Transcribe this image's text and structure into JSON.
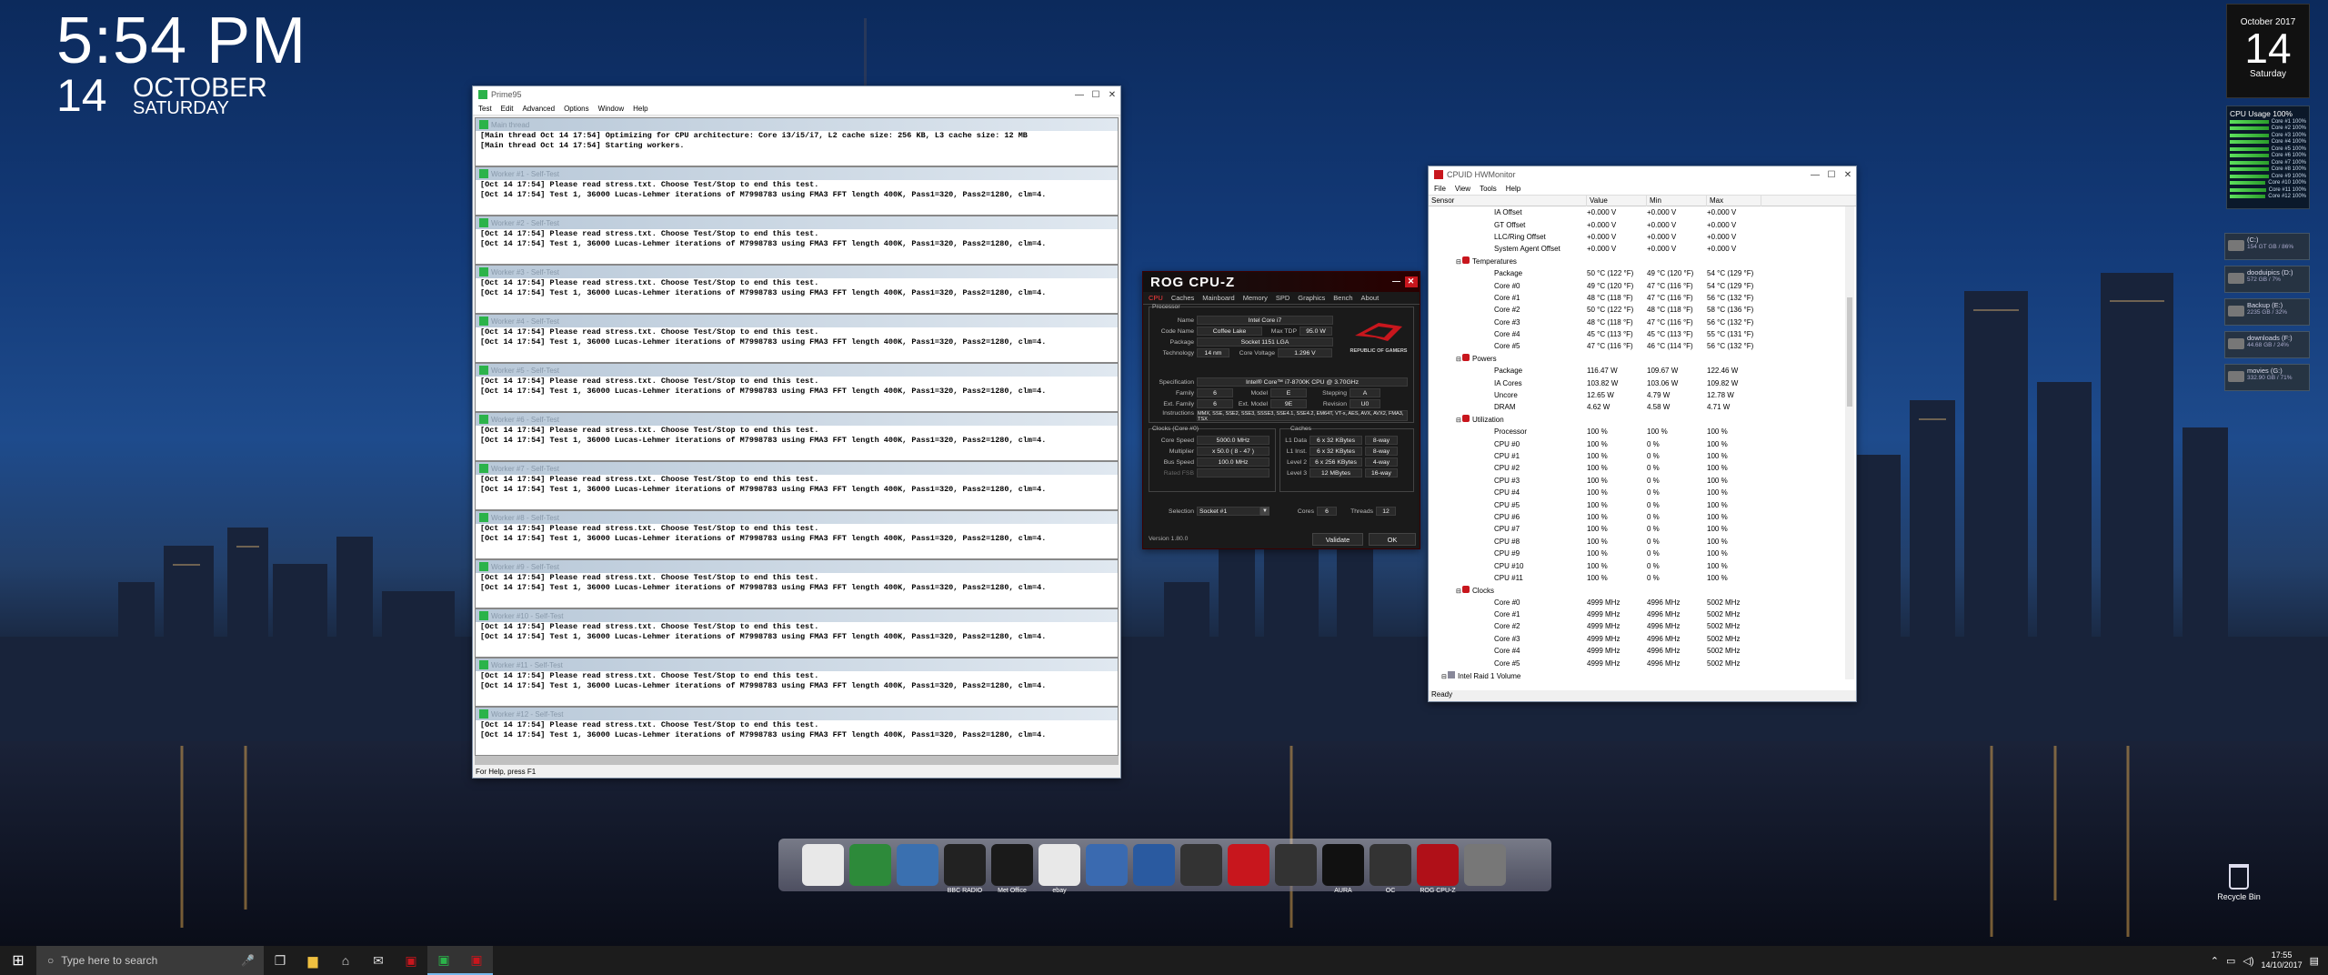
{
  "desktop": {
    "clock": {
      "time": "5:54 PM",
      "day": "14",
      "month": "OCTOBER",
      "weekday": "SATURDAY"
    },
    "calendar": {
      "month_year": "October 2017",
      "day": "14",
      "weekday": "Saturday"
    },
    "cpu_gadget": {
      "title": "CPU Usage 100%",
      "cores": [
        "Core #1 100%",
        "Core #2 100%",
        "Core #3 100%",
        "Core #4 100%",
        "Core #5 100%",
        "Core #6 100%",
        "Core #7 100%",
        "Core #8 100%",
        "Core #9 100%",
        "Core #10 100%",
        "Core #11 100%",
        "Core #12 100%"
      ]
    },
    "drives": [
      {
        "name": "(C:)",
        "cap": "154 GT GB / 86%"
      },
      {
        "name": "dooduipics (D:)",
        "cap": "572 GB / 7%"
      },
      {
        "name": "Backup (E:)",
        "cap": "2235 GB / 32%"
      },
      {
        "name": "downloads (F:)",
        "cap": "44.68 GB / 24%"
      },
      {
        "name": "movies (G:)",
        "cap": "332.90 GB / 71%"
      }
    ],
    "recycle_bin": "Recycle Bin"
  },
  "prime95": {
    "title": "Prime95",
    "menu": [
      "Test",
      "Edit",
      "Advanced",
      "Options",
      "Window",
      "Help"
    ],
    "main_thread": {
      "title": "Main thread",
      "lines": [
        "[Main thread Oct 14 17:54] Optimizing for CPU architecture: Core i3/i5/i7, L2 cache size: 256 KB, L3 cache size: 12 MB",
        "[Main thread Oct 14 17:54] Starting workers."
      ]
    },
    "workers": [
      {
        "title": "Worker #1 - Self-Test"
      },
      {
        "title": "Worker #2 - Self-Test"
      },
      {
        "title": "Worker #3 - Self-Test"
      },
      {
        "title": "Worker #4 - Self-Test"
      },
      {
        "title": "Worker #5 - Self-Test"
      },
      {
        "title": "Worker #6 - Self-Test"
      },
      {
        "title": "Worker #7 - Self-Test"
      },
      {
        "title": "Worker #8 - Self-Test"
      },
      {
        "title": "Worker #9 - Self-Test"
      },
      {
        "title": "Worker #10 - Self-Test"
      },
      {
        "title": "Worker #11 - Self-Test"
      },
      {
        "title": "Worker #12 - Self-Test"
      }
    ],
    "worker_line1": "[Oct 14 17:54] Please read stress.txt.  Choose Test/Stop to end this test.",
    "worker_line2": "[Oct 14 17:54] Test 1, 36000 Lucas-Lehmer iterations of M7998783 using FMA3 FFT length 400K, Pass1=320, Pass2=1280, clm=4.",
    "status": "For Help, press F1"
  },
  "cpuz": {
    "title": "ROG CPU-Z",
    "tabs": [
      "CPU",
      "Caches",
      "Mainboard",
      "Memory",
      "SPD",
      "Graphics",
      "Bench",
      "About"
    ],
    "processor": {
      "group": "Processor",
      "name_label": "Name",
      "name": "Intel Core i7",
      "codename_label": "Code Name",
      "codename": "Coffee Lake",
      "maxtdp_label": "Max TDP",
      "maxtdp": "95.0 W",
      "package_label": "Package",
      "package": "Socket 1151 LGA",
      "tech_label": "Technology",
      "tech": "14 nm",
      "voltage_label": "Core Voltage",
      "voltage": "1.296 V",
      "spec_label": "Specification",
      "spec": "Intel® Core™ i7-8700K CPU @ 3.70GHz",
      "family_label": "Family",
      "family": "6",
      "model_label": "Model",
      "model": "E",
      "stepping_label": "Stepping",
      "stepping": "A",
      "extfamily_label": "Ext. Family",
      "extfamily": "6",
      "extmodel_label": "Ext. Model",
      "extmodel": "9E",
      "revision_label": "Revision",
      "revision": "U0",
      "instr_label": "Instructions",
      "instr": "MMX, SSE, SSE2, SSE3, SSSE3, SSE4.1, SSE4.2, EM64T, VT-x, AES, AVX, AVX2, FMA3, TSX"
    },
    "clocks": {
      "group": "Clocks (Core #0)",
      "speed_label": "Core Speed",
      "speed": "5000.0 MHz",
      "mult_label": "Multiplier",
      "mult": "x 50.0 ( 8 - 47 )",
      "bus_label": "Bus Speed",
      "bus": "100.0 MHz",
      "fsb_label": "Rated FSB",
      "fsb": ""
    },
    "caches": {
      "group": "Caches",
      "l1d_label": "L1 Data",
      "l1d": "6 x 32 KBytes",
      "l1d_way": "8-way",
      "l1i_label": "L1 Inst.",
      "l1i": "6 x 32 KBytes",
      "l1i_way": "8-way",
      "l2_label": "Level 2",
      "l2": "6 x 256 KBytes",
      "l2_way": "4-way",
      "l3_label": "Level 3",
      "l3": "12 MBytes",
      "l3_way": "16-way"
    },
    "selection_label": "Selection",
    "selection": "Socket #1",
    "cores_label": "Cores",
    "cores": "6",
    "threads_label": "Threads",
    "threads": "12",
    "version": "Version 1.80.0",
    "validate": "Validate",
    "ok": "OK",
    "rog_text": "REPUBLIC OF GAMERS"
  },
  "hwmon": {
    "title": "CPUID HWMonitor",
    "menu": [
      "File",
      "View",
      "Tools",
      "Help"
    ],
    "columns": [
      "Sensor",
      "Value",
      "Min",
      "Max"
    ],
    "rows": [
      {
        "n": "IA Offset",
        "v": "+0.000 V",
        "mn": "+0.000 V",
        "mx": "+0.000 V",
        "lvl": 2
      },
      {
        "n": "GT Offset",
        "v": "+0.000 V",
        "mn": "+0.000 V",
        "mx": "+0.000 V",
        "lvl": 2
      },
      {
        "n": "LLC/Ring Offset",
        "v": "+0.000 V",
        "mn": "+0.000 V",
        "mx": "+0.000 V",
        "lvl": 2
      },
      {
        "n": "System Agent Offset",
        "v": "+0.000 V",
        "mn": "+0.000 V",
        "mx": "+0.000 V",
        "lvl": 2
      },
      {
        "n": "Temperatures",
        "v": "",
        "mn": "",
        "mx": "",
        "lvl": 1
      },
      {
        "n": "Package",
        "v": "50 °C (122 °F)",
        "mn": "49 °C (120 °F)",
        "mx": "54 °C (129 °F)",
        "lvl": 2
      },
      {
        "n": "Core #0",
        "v": "49 °C (120 °F)",
        "mn": "47 °C (116 °F)",
        "mx": "54 °C (129 °F)",
        "lvl": 2
      },
      {
        "n": "Core #1",
        "v": "48 °C (118 °F)",
        "mn": "47 °C (116 °F)",
        "mx": "56 °C (132 °F)",
        "lvl": 2
      },
      {
        "n": "Core #2",
        "v": "50 °C (122 °F)",
        "mn": "48 °C (118 °F)",
        "mx": "58 °C (136 °F)",
        "lvl": 2
      },
      {
        "n": "Core #3",
        "v": "48 °C (118 °F)",
        "mn": "47 °C (116 °F)",
        "mx": "56 °C (132 °F)",
        "lvl": 2
      },
      {
        "n": "Core #4",
        "v": "45 °C (113 °F)",
        "mn": "45 °C (113 °F)",
        "mx": "55 °C (131 °F)",
        "lvl": 2
      },
      {
        "n": "Core #5",
        "v": "47 °C (116 °F)",
        "mn": "46 °C (114 °F)",
        "mx": "56 °C (132 °F)",
        "lvl": 2
      },
      {
        "n": "Powers",
        "v": "",
        "mn": "",
        "mx": "",
        "lvl": 1
      },
      {
        "n": "Package",
        "v": "116.47 W",
        "mn": "109.67 W",
        "mx": "122.46 W",
        "lvl": 2
      },
      {
        "n": "IA Cores",
        "v": "103.82 W",
        "mn": "103.06 W",
        "mx": "109.82 W",
        "lvl": 2
      },
      {
        "n": "Uncore",
        "v": "12.65 W",
        "mn": "4.79 W",
        "mx": "12.78 W",
        "lvl": 2
      },
      {
        "n": "DRAM",
        "v": "4.62 W",
        "mn": "4.58 W",
        "mx": "4.71 W",
        "lvl": 2
      },
      {
        "n": "Utilization",
        "v": "",
        "mn": "",
        "mx": "",
        "lvl": 1
      },
      {
        "n": "Processor",
        "v": "100 %",
        "mn": "100 %",
        "mx": "100 %",
        "lvl": 2
      },
      {
        "n": "CPU #0",
        "v": "100 %",
        "mn": "0 %",
        "mx": "100 %",
        "lvl": 2
      },
      {
        "n": "CPU #1",
        "v": "100 %",
        "mn": "0 %",
        "mx": "100 %",
        "lvl": 2
      },
      {
        "n": "CPU #2",
        "v": "100 %",
        "mn": "0 %",
        "mx": "100 %",
        "lvl": 2
      },
      {
        "n": "CPU #3",
        "v": "100 %",
        "mn": "0 %",
        "mx": "100 %",
        "lvl": 2
      },
      {
        "n": "CPU #4",
        "v": "100 %",
        "mn": "0 %",
        "mx": "100 %",
        "lvl": 2
      },
      {
        "n": "CPU #5",
        "v": "100 %",
        "mn": "0 %",
        "mx": "100 %",
        "lvl": 2
      },
      {
        "n": "CPU #6",
        "v": "100 %",
        "mn": "0 %",
        "mx": "100 %",
        "lvl": 2
      },
      {
        "n": "CPU #7",
        "v": "100 %",
        "mn": "0 %",
        "mx": "100 %",
        "lvl": 2
      },
      {
        "n": "CPU #8",
        "v": "100 %",
        "mn": "0 %",
        "mx": "100 %",
        "lvl": 2
      },
      {
        "n": "CPU #9",
        "v": "100 %",
        "mn": "0 %",
        "mx": "100 %",
        "lvl": 2
      },
      {
        "n": "CPU #10",
        "v": "100 %",
        "mn": "0 %",
        "mx": "100 %",
        "lvl": 2
      },
      {
        "n": "CPU #11",
        "v": "100 %",
        "mn": "0 %",
        "mx": "100 %",
        "lvl": 2
      },
      {
        "n": "Clocks",
        "v": "",
        "mn": "",
        "mx": "",
        "lvl": 1
      },
      {
        "n": "Core #0",
        "v": "4999 MHz",
        "mn": "4996 MHz",
        "mx": "5002 MHz",
        "lvl": 2
      },
      {
        "n": "Core #1",
        "v": "4999 MHz",
        "mn": "4996 MHz",
        "mx": "5002 MHz",
        "lvl": 2
      },
      {
        "n": "Core #2",
        "v": "4999 MHz",
        "mn": "4996 MHz",
        "mx": "5002 MHz",
        "lvl": 2
      },
      {
        "n": "Core #3",
        "v": "4999 MHz",
        "mn": "4996 MHz",
        "mx": "5002 MHz",
        "lvl": 2
      },
      {
        "n": "Core #4",
        "v": "4999 MHz",
        "mn": "4996 MHz",
        "mx": "5002 MHz",
        "lvl": 2
      },
      {
        "n": "Core #5",
        "v": "4999 MHz",
        "mn": "4996 MHz",
        "mx": "5002 MHz",
        "lvl": 2
      },
      {
        "n": "Intel Raid 1 Volume",
        "v": "",
        "mn": "",
        "mx": "",
        "lvl": 0
      }
    ],
    "status": "Ready"
  },
  "dock": {
    "items": [
      {
        "icon": "chrome-icon",
        "label": ""
      },
      {
        "icon": "bank-icon",
        "label": ""
      },
      {
        "icon": "sync-icon",
        "label": ""
      },
      {
        "icon": "bbc-radio-icon",
        "label": "BBC RADIO"
      },
      {
        "icon": "met-office-icon",
        "label": "Met Office"
      },
      {
        "icon": "ebay-icon",
        "label": "ebay"
      },
      {
        "icon": "notes-icon",
        "label": ""
      },
      {
        "icon": "monitor-icon",
        "label": ""
      },
      {
        "icon": "rog-icon",
        "label": ""
      },
      {
        "icon": "bolt-icon",
        "label": ""
      },
      {
        "icon": "camera-icon",
        "label": ""
      },
      {
        "icon": "aura-icon",
        "label": "AURA"
      },
      {
        "icon": "oc-panel-icon",
        "label": "OC"
      },
      {
        "icon": "cpu-z-icon",
        "label": "ROG CPU-Z"
      },
      {
        "icon": "tools-icon",
        "label": ""
      }
    ]
  },
  "taskbar": {
    "search_placeholder": "Type here to search",
    "time": "17:55",
    "date": "14/10/2017"
  },
  "colors": {
    "accent": "#c8161d",
    "prime_green": "#2bb34a",
    "taskbar": "#1c1c1c"
  }
}
